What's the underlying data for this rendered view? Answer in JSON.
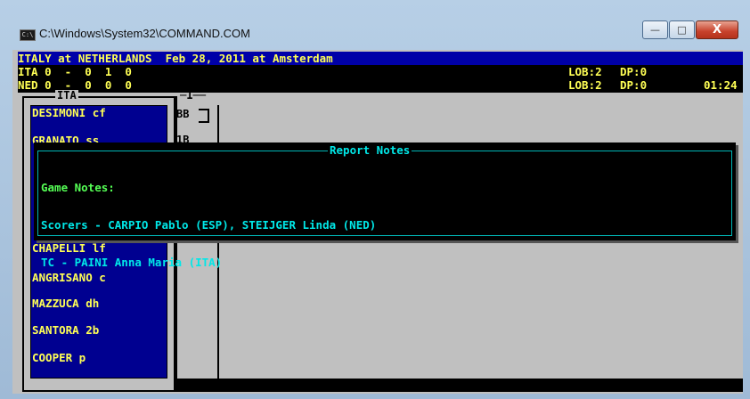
{
  "window": {
    "title": "C:\\Windows\\System32\\COMMAND.COM",
    "icon_text": "C:\\",
    "buttons": {
      "minimize": "—",
      "maximize": "□",
      "close": "X"
    }
  },
  "scoreboard": {
    "header": "ITALY at NETHERLANDS  Feb 28, 2011 at Amsterdam",
    "teams": [
      {
        "line": "ITA 0  -  0  1  0",
        "lob": "LOB:2",
        "dp": "DP:0",
        "time": ""
      },
      {
        "line": "NED 0  -  0  0  0",
        "lob": "LOB:2",
        "dp": "DP:0",
        "time": "01:24"
      }
    ]
  },
  "lineup": {
    "title": "ITA",
    "players": [
      "DESIMONI cf",
      "GRANATO ss",
      "",
      "",
      "",
      "CHAPELLI lf",
      "ANGRISANO c",
      "MAZZUCA dh",
      "SANTORA 2b",
      "COOPER p"
    ]
  },
  "inning": {
    "number": "1",
    "cells": [
      "BB",
      "1B"
    ]
  },
  "report_notes": {
    "title": "Report Notes",
    "heading": "Game Notes:",
    "lines": [
      "Scorers - CARPIO Pablo (ESP), STEIJGER Linda (NED)",
      "TC - PAINI Anna Maria (ITA)"
    ]
  },
  "colors": {
    "console_bg": "#c0c0c0",
    "panel_blue": "#000090",
    "text_yellow": "#ffff55",
    "notes_cyan": "#00e8e8",
    "notes_green": "#55ff55"
  }
}
